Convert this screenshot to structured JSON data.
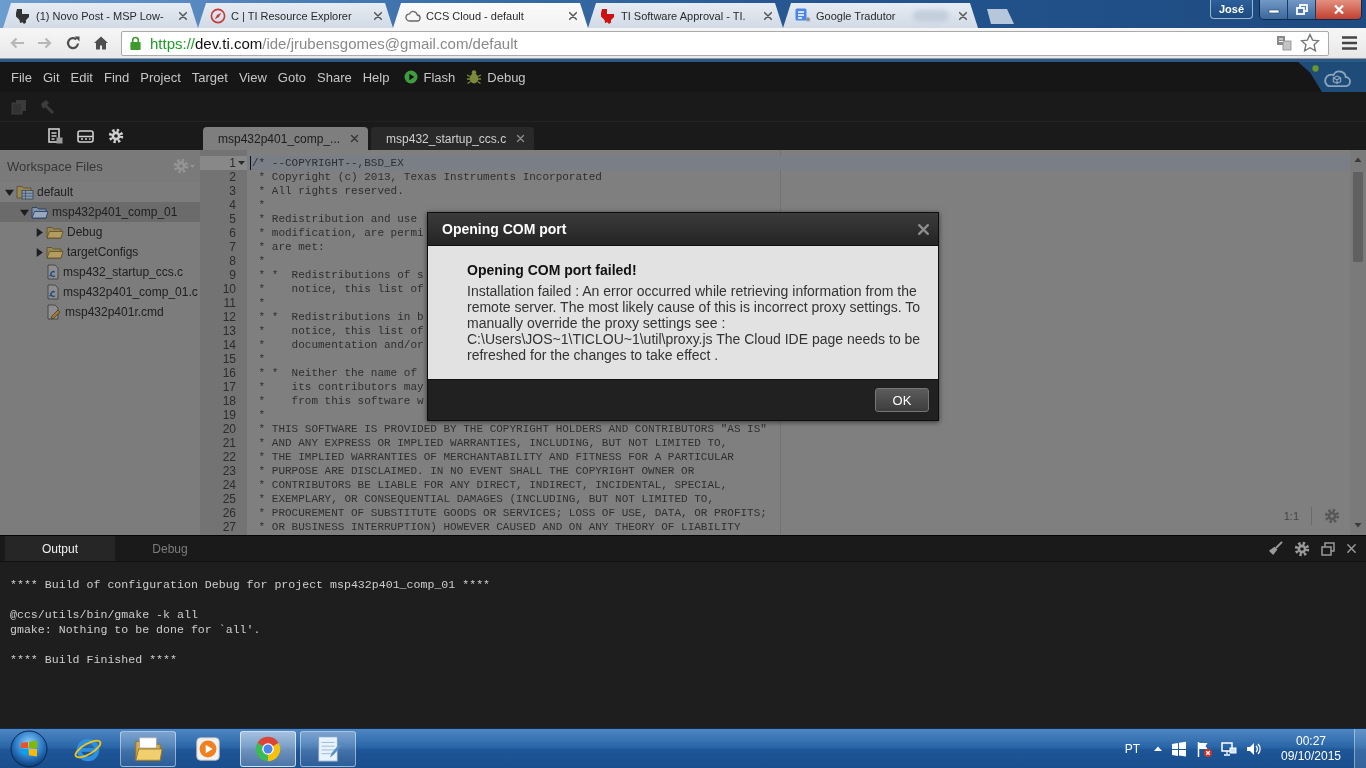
{
  "browser": {
    "tabs": [
      {
        "title": "(1) Novo Post - MSP Low-",
        "selected": false
      },
      {
        "title": "C | TI Resource Explorer",
        "selected": false
      },
      {
        "title": "CCS Cloud - default",
        "selected": true
      },
      {
        "title": "TI Software Approval - TI.",
        "selected": false
      },
      {
        "title": "Google Tradutor",
        "selected": false
      }
    ],
    "profile": "José",
    "address": {
      "scheme": "https://",
      "host": "dev.ti.com",
      "path": "/ide/jrubensgomes@gmail.com/default"
    }
  },
  "ide": {
    "menu": [
      "File",
      "Git",
      "Edit",
      "Find",
      "Project",
      "Target",
      "View",
      "Goto",
      "Share",
      "Help"
    ],
    "run_buttons": [
      "Flash",
      "Debug"
    ],
    "sidebar": {
      "title": "Workspace Files",
      "tree": [
        {
          "label": "default",
          "kind": "workspace",
          "expanded": true,
          "selected": false,
          "children": [
            {
              "label": "msp432p401_comp_01",
              "kind": "project",
              "expanded": true,
              "selected": true,
              "children": [
                {
                  "label": "Debug",
                  "kind": "folder",
                  "expanded": false,
                  "selected": false
                },
                {
                  "label": "targetConfigs",
                  "kind": "folder",
                  "expanded": false,
                  "selected": false
                },
                {
                  "label": "msp432_startup_ccs.c",
                  "kind": "c-file",
                  "selected": false
                },
                {
                  "label": "msp432p401_comp_01.c",
                  "kind": "c-file",
                  "selected": false
                },
                {
                  "label": "msp432p401r.cmd",
                  "kind": "cmd-file",
                  "selected": false
                }
              ]
            }
          ]
        }
      ]
    },
    "editor": {
      "tabs": [
        {
          "title": "msp432p401_comp_...",
          "selected": true
        },
        {
          "title": "msp432_startup_ccs.c",
          "selected": false
        }
      ],
      "lines": [
        {
          "number": "1",
          "text": "/* --COPYRIGHT--,BSD_EX",
          "active": true,
          "foldable": true
        },
        {
          "number": "2",
          "text": " * Copyright (c) 2013, Texas Instruments Incorporated",
          "active": false,
          "foldable": false
        },
        {
          "number": "3",
          "text": " * All rights reserved.",
          "active": false,
          "foldable": false
        },
        {
          "number": "4",
          "text": " *",
          "active": false,
          "foldable": false
        },
        {
          "number": "5",
          "text": " * Redistribution and use",
          "active": false,
          "foldable": false
        },
        {
          "number": "6",
          "text": " * modification, are permi",
          "active": false,
          "foldable": false
        },
        {
          "number": "7",
          "text": " * are met:",
          "active": false,
          "foldable": false
        },
        {
          "number": "8",
          "text": " *",
          "active": false,
          "foldable": false
        },
        {
          "number": "9",
          "text": " * *  Redistributions of s",
          "active": false,
          "foldable": false
        },
        {
          "number": "10",
          "text": " *    notice, this list of",
          "active": false,
          "foldable": false
        },
        {
          "number": "11",
          "text": " *",
          "active": false,
          "foldable": false
        },
        {
          "number": "12",
          "text": " * *  Redistributions in b",
          "active": false,
          "foldable": false
        },
        {
          "number": "13",
          "text": " *    notice, this list of",
          "active": false,
          "foldable": false
        },
        {
          "number": "14",
          "text": " *    documentation and/or",
          "active": false,
          "foldable": false
        },
        {
          "number": "15",
          "text": " *",
          "active": false,
          "foldable": false
        },
        {
          "number": "16",
          "text": " * *  Neither the name of",
          "active": false,
          "foldable": false
        },
        {
          "number": "17",
          "text": " *    its contributors may",
          "active": false,
          "foldable": false
        },
        {
          "number": "18",
          "text": " *    from this software w",
          "active": false,
          "foldable": false
        },
        {
          "number": "19",
          "text": " *",
          "active": false,
          "foldable": false
        },
        {
          "number": "20",
          "text": " * THIS SOFTWARE IS PROVIDED BY THE COPYRIGHT HOLDERS AND CONTRIBUTORS \"AS IS\"",
          "active": false,
          "foldable": false
        },
        {
          "number": "21",
          "text": " * AND ANY EXPRESS OR IMPLIED WARRANTIES, INCLUDING, BUT NOT LIMITED TO,",
          "active": false,
          "foldable": false
        },
        {
          "number": "22",
          "text": " * THE IMPLIED WARRANTIES OF MERCHANTABILITY AND FITNESS FOR A PARTICULAR",
          "active": false,
          "foldable": false
        },
        {
          "number": "23",
          "text": " * PURPOSE ARE DISCLAIMED. IN NO EVENT SHALL THE COPYRIGHT OWNER OR",
          "active": false,
          "foldable": false
        },
        {
          "number": "24",
          "text": " * CONTRIBUTORS BE LIABLE FOR ANY DIRECT, INDIRECT, INCIDENTAL, SPECIAL,",
          "active": false,
          "foldable": false
        },
        {
          "number": "25",
          "text": " * EXEMPLARY, OR CONSEQUENTIAL DAMAGES (INCLUDING, BUT NOT LIMITED TO,",
          "active": false,
          "foldable": false
        },
        {
          "number": "26",
          "text": " * PROCUREMENT OF SUBSTITUTE GOODS OR SERVICES; LOSS OF USE, DATA, OR PROFITS;",
          "active": false,
          "foldable": false
        },
        {
          "number": "27",
          "text": " * OR BUSINESS INTERRUPTION) HOWEVER CAUSED AND ON ANY THEORY OF LIABILITY",
          "active": false,
          "foldable": false
        }
      ],
      "cursor_position": "1:1"
    },
    "bottom_panel": {
      "tabs": [
        {
          "label": "Output",
          "selected": true
        },
        {
          "label": "Debug",
          "selected": false
        }
      ],
      "blocks": [
        {
          "lines": [
            "**** Build of configuration Debug for project msp432p401_comp_01 ****"
          ]
        },
        {
          "lines": [
            "@ccs/utils/bin/gmake -k all",
            "gmake: Nothing to be done for `all'."
          ]
        },
        {
          "lines": [
            "**** Build Finished ****"
          ]
        }
      ]
    }
  },
  "dialog": {
    "title": "Opening COM port",
    "heading": "Opening COM port failed!",
    "message": "Installation failed : An error occurred while retrieving information from the remote server. The most likely cause of this is incorrect proxy settings. To manually override the proxy settings see : C:\\Users\\JOS~1\\TICLOU~1\\util\\proxy.js The Cloud IDE page needs to be refreshed for the changes to take effect .",
    "buttons": [
      "OK"
    ]
  },
  "taskbar": {
    "apps": [
      {
        "running": false,
        "selected": false
      },
      {
        "running": true,
        "selected": false
      },
      {
        "running": false,
        "selected": false
      },
      {
        "running": true,
        "selected": true
      },
      {
        "running": true,
        "selected": false
      }
    ],
    "language": "PT",
    "time": "00:27",
    "date": "09/10/2015"
  }
}
